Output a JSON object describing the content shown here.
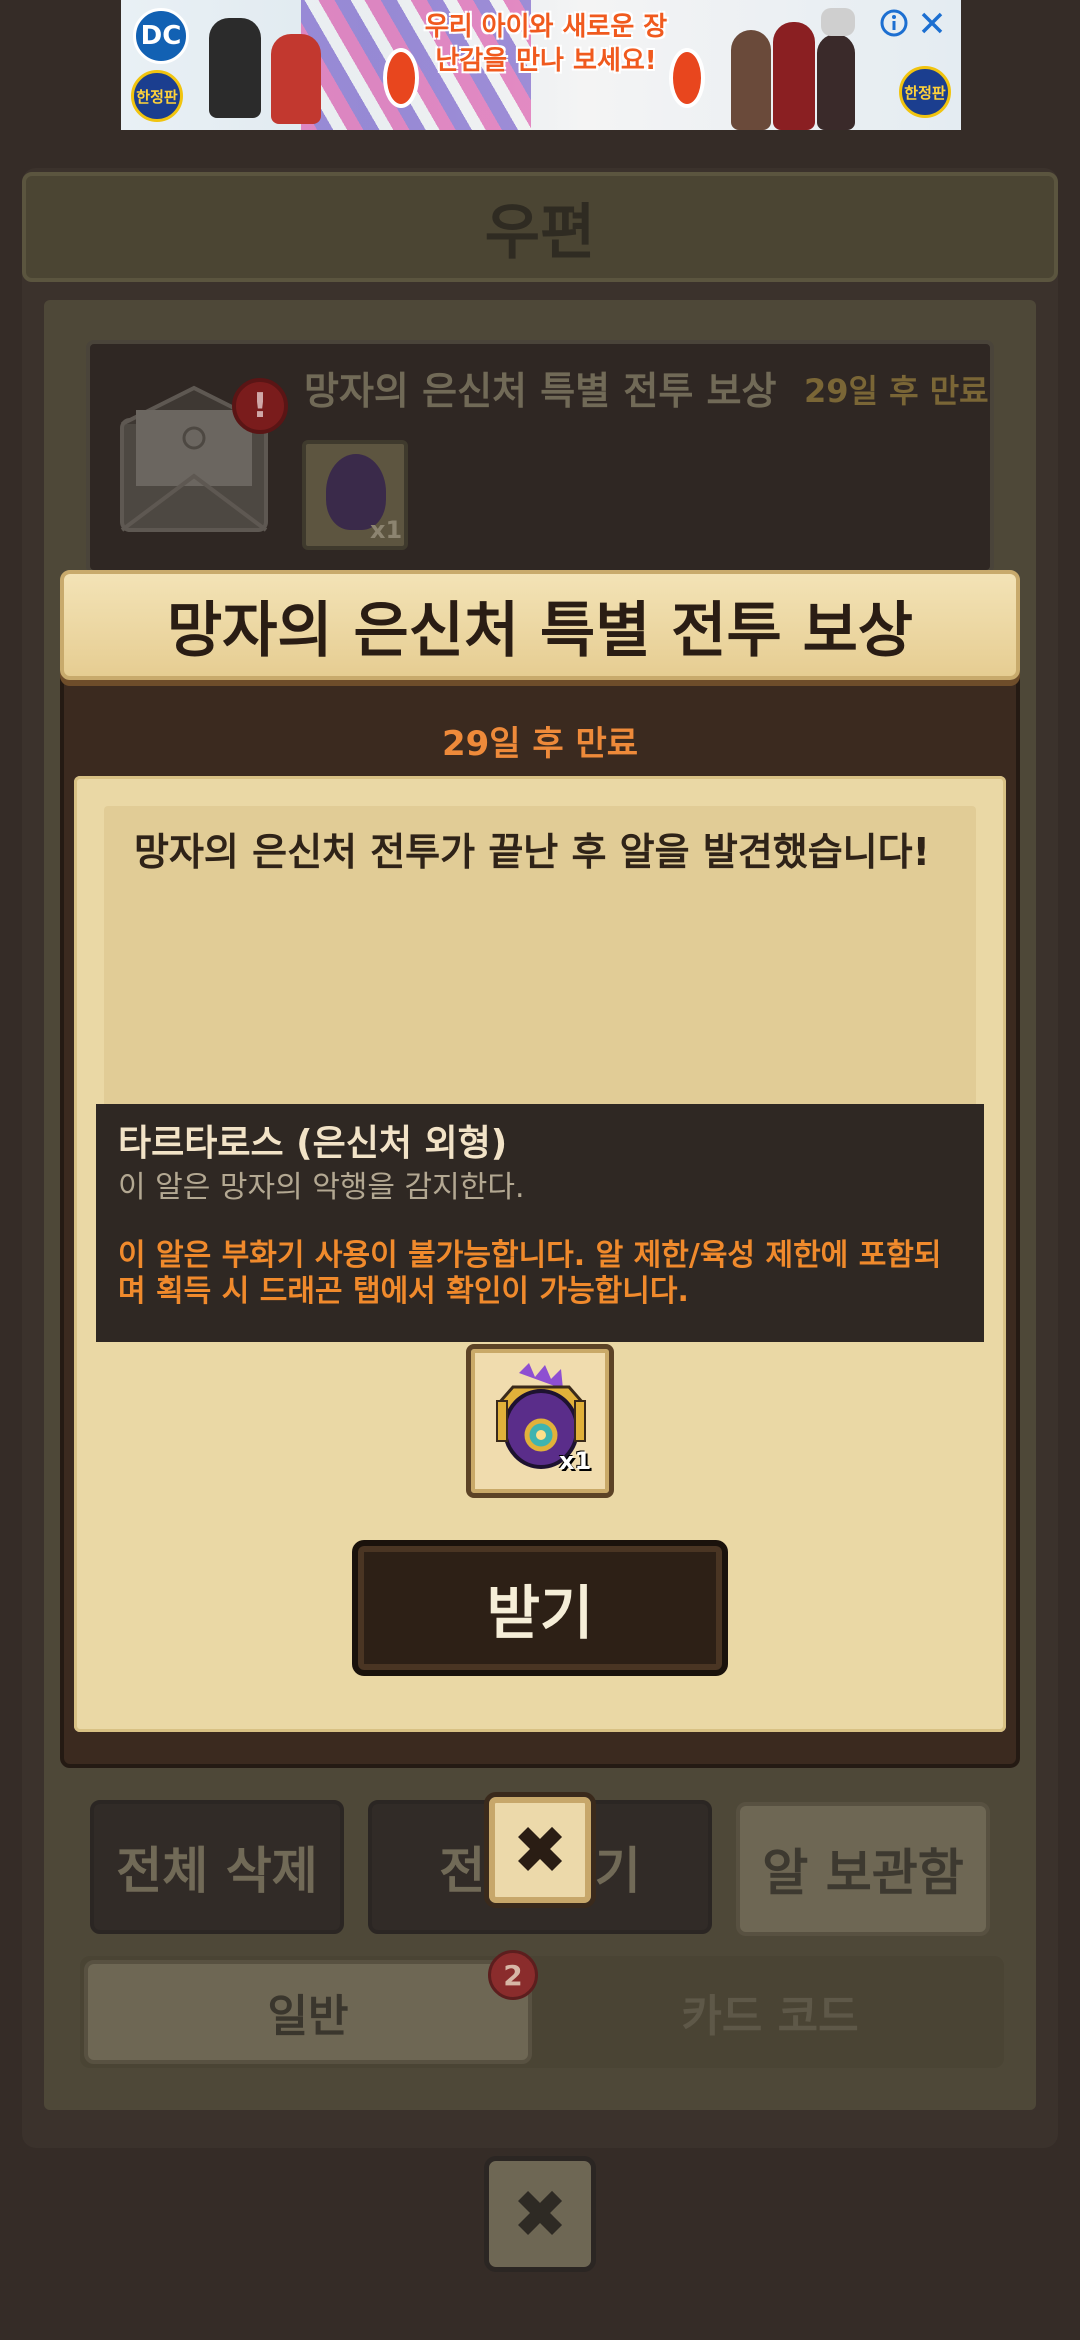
{
  "ad": {
    "headline": "우리 아이와 새로운 장난감을 만나 보세요!",
    "logo_left": "DC",
    "edition_badge": "한정판",
    "info_icon": "info-icon",
    "close_icon": "close-icon"
  },
  "mail": {
    "title": "우편",
    "item": {
      "title": "망자의 은신처 특별 전투 보상",
      "expiry": "29일 후 만료",
      "qty": "x1"
    },
    "buttons": {
      "delete_all": "전체 삭제",
      "receive_all": "전체 받기",
      "egg_storage": "알 보관함"
    },
    "tabs": {
      "general": "일반",
      "general_badge": "2",
      "card_code": "카드 코드"
    }
  },
  "modal": {
    "title": "망자의 은신처 특별 전투 보상",
    "expiry": "29일 후 만료",
    "message": "망자의 은신처 전투가 끝난 후 알을 발견했습니다!",
    "tooltip": {
      "name": "타르타로스 (은신처 외형)",
      "description": "이 알은 망자의 악행을 감지한다.",
      "warning": "이 알은 부화기 사용이 불가능합니다. 알 제한/육성 제한에 포함되며 획득 시 드래곤 탭에서 확인이 가능합니다."
    },
    "reward_qty": "x1",
    "receive_label": "받기",
    "close_glyph": "✖"
  },
  "colors": {
    "background": "#352c27",
    "paper": "#ead8a5",
    "expiry_orange": "#ee8a3a",
    "warning_orange": "#f08a2c",
    "button_dark": "#2d2016"
  }
}
